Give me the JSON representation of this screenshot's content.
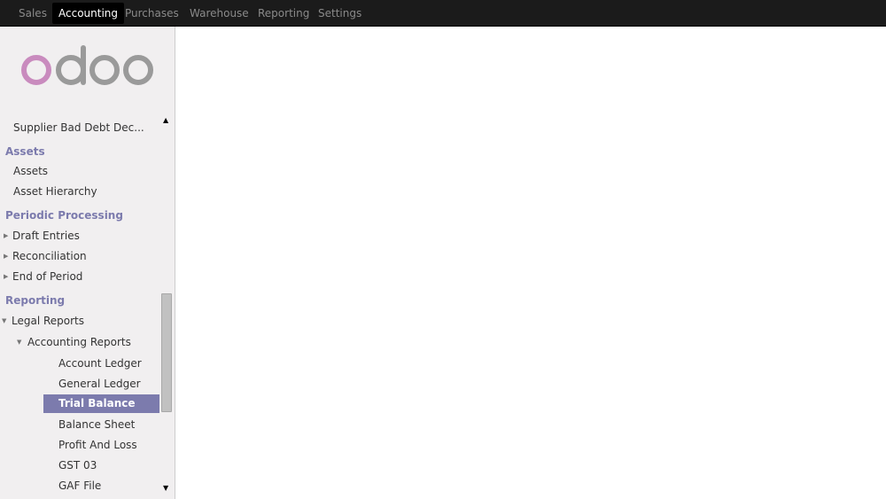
{
  "topbar": {
    "items": [
      "Sales",
      "Accounting",
      "Purchases",
      "Warehouse",
      "Reporting",
      "Settings"
    ],
    "active": "Accounting"
  },
  "logo": {
    "text": "odoo"
  },
  "sidebar": {
    "entries": [
      {
        "label": "Supplier Bad Debt Dec..."
      },
      {
        "label": "Assets"
      },
      {
        "label": "Assets"
      },
      {
        "label": "Asset Hierarchy"
      },
      {
        "label": "Periodic Processing"
      },
      {
        "label": "Draft Entries"
      },
      {
        "label": "Reconciliation"
      },
      {
        "label": "End of Period"
      },
      {
        "label": "Reporting"
      },
      {
        "label": "Legal Reports"
      },
      {
        "label": "Accounting Reports"
      },
      {
        "label": "Account Ledger"
      },
      {
        "label": "General Ledger"
      },
      {
        "label": "Trial Balance"
      },
      {
        "label": "Balance Sheet"
      },
      {
        "label": "Profit And Loss"
      },
      {
        "label": "GST 03"
      },
      {
        "label": "GAF File"
      }
    ],
    "selected": "Trial Balance"
  },
  "colors": {
    "topbar_bg": "#1b1b1b",
    "accent": "#7c7bad",
    "sidebar_bg": "#f1eff0",
    "logo_o1": "#c98bbe",
    "logo_rest": "#9a9a9a"
  },
  "icons": {
    "collapsed_caret": "caret-right-icon",
    "expanded_caret": "caret-down-icon",
    "scroll_up": "arrow-up-icon",
    "scroll_down": "arrow-down-icon"
  }
}
